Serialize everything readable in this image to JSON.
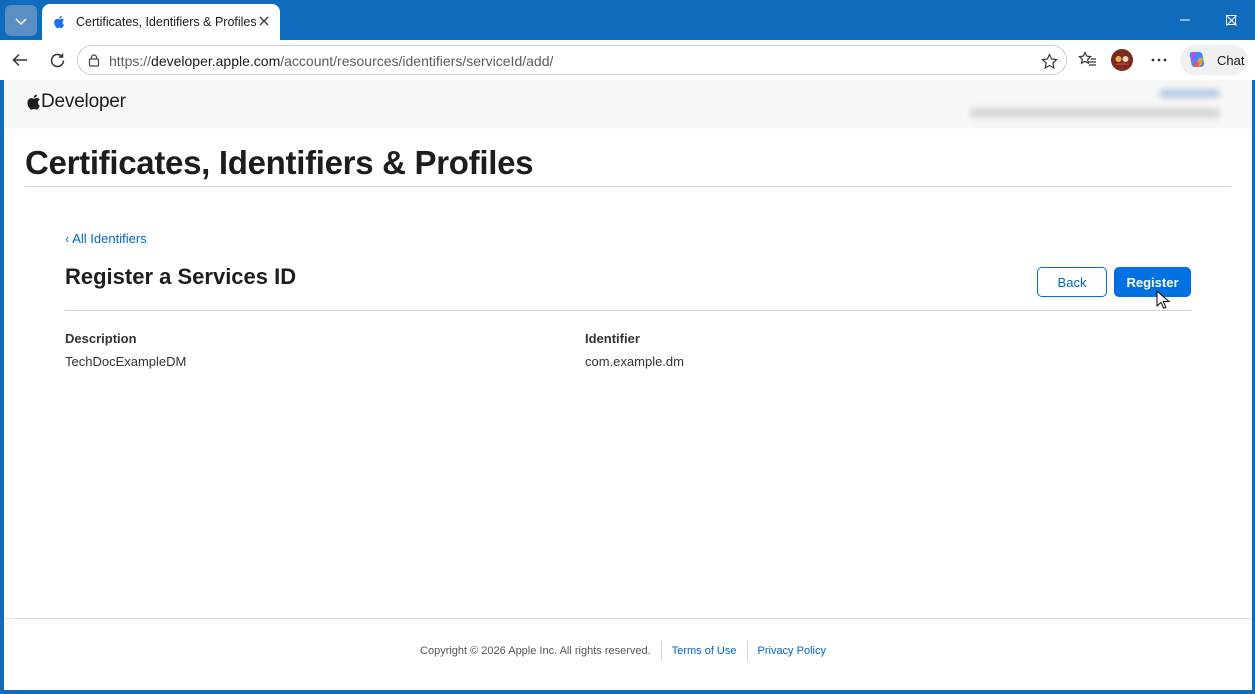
{
  "browser": {
    "tab_title": "Certificates, Identifiers & Profiles -",
    "url_prefix": "https://",
    "url_host": "developer.apple.com",
    "url_path": "/account/resources/identifiers/serviceId/add/",
    "chat_label": "Chat"
  },
  "site": {
    "logo_text": "Developer"
  },
  "page": {
    "title": "Certificates, Identifiers & Profiles",
    "back_link": "‹ All Identifiers",
    "section_title": "Register a Services ID",
    "buttons": {
      "back": "Back",
      "register": "Register"
    },
    "fields": [
      {
        "label": "Description",
        "value": "TechDocExampleDM"
      },
      {
        "label": "Identifier",
        "value": "com.example.dm"
      }
    ]
  },
  "footer": {
    "copyright": "Copyright © 2026 Apple Inc. All rights reserved.",
    "links": [
      "Terms of Use",
      "Privacy Policy"
    ]
  },
  "colors": {
    "titlebar": "#0f6cbd",
    "accent": "#0071e3",
    "link": "#0066cc"
  }
}
